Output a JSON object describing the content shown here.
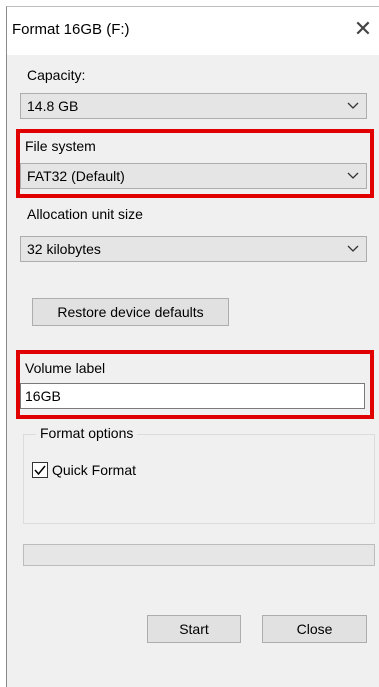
{
  "window": {
    "title": "Format 16GB (F:)"
  },
  "icons": {
    "close": "close-icon",
    "dropdown": "chevron-down-icon",
    "check": "checkmark-icon"
  },
  "capacity": {
    "label": "Capacity:",
    "value": "14.8 GB"
  },
  "file_system": {
    "label": "File system",
    "value": "FAT32 (Default)"
  },
  "allocation": {
    "label": "Allocation unit size",
    "value": "32 kilobytes"
  },
  "restore_button": "Restore device defaults",
  "volume": {
    "label": "Volume label",
    "value": "16GB"
  },
  "format_options": {
    "label": "Format options",
    "quick_format": {
      "label": "Quick Format",
      "checked": true
    }
  },
  "progress": {
    "value": 0
  },
  "buttons": {
    "start": "Start",
    "close": "Close"
  },
  "highlight_color": "#e00000"
}
